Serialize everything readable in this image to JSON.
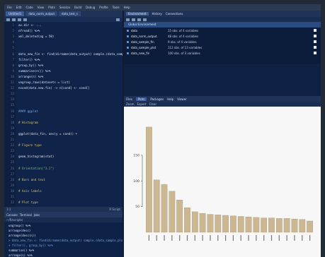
{
  "menubar": {
    "items": [
      "File",
      "Edit",
      "Code",
      "View",
      "Plots",
      "Session",
      "Build",
      "Debug",
      "Profile",
      "Tools",
      "Help"
    ]
  },
  "source": {
    "tabs": [
      "Untitled1",
      "data_norm_output",
      "data_test_s"
    ],
    "status_left": "1:1",
    "status_right": "R Script",
    "lines": [
      {
        "n": "1",
        "t": "  ax.dir <- ...",
        "c": "c-w"
      },
      {
        "n": "2",
        "t": "  nfread() %>%",
        "c": "c-w"
      },
      {
        "n": "3",
        "t": "  xml_deleted(ag = 50)",
        "c": "c-w"
      },
      {
        "n": "4",
        "t": "",
        "c": "c-w"
      },
      {
        "n": "5",
        "t": "",
        "c": "c-w"
      },
      {
        "n": "6",
        "t": "data_new_fin <- find(dirname(data_output) sample.(data_sample_plot)",
        "c": "c-w"
      },
      {
        "n": "7",
        "t": "  filter() %>%",
        "c": "c-w"
      },
      {
        "n": "8",
        "t": "  group_by() %>%",
        "c": "c-w"
      },
      {
        "n": "9",
        "t": "  summarise(n()) %>%",
        "c": "c-w"
      },
      {
        "n": "10",
        "t": "  arrange(n) %>%",
        "c": "c-w"
      },
      {
        "n": "11",
        "t": "  ungroup_rows(datasets = list)",
        "c": "c-w"
      },
      {
        "n": "12",
        "t": "ncond(data.new.fin) -> n[cond] <- cond[]",
        "c": "c-w"
      },
      {
        "n": "13",
        "t": "",
        "c": "c-w"
      },
      {
        "n": "14",
        "t": "",
        "c": "c-w"
      },
      {
        "n": "15",
        "t": "",
        "c": "c-w"
      },
      {
        "n": "16",
        "t": "#### ggplot",
        "c": "c-b"
      },
      {
        "n": "17",
        "t": "",
        "c": "c-w"
      },
      {
        "n": "18",
        "t": "# Histogram",
        "c": "c-y"
      },
      {
        "n": "19",
        "t": "",
        "c": "c-w"
      },
      {
        "n": "20",
        "t": "ggplot(data_fin, aes(y = cond)) +",
        "c": "c-w"
      },
      {
        "n": "21",
        "t": "",
        "c": "c-w"
      },
      {
        "n": "22",
        "t": "  # Figure type",
        "c": "c-y"
      },
      {
        "n": "23",
        "t": "",
        "c": "c-w"
      },
      {
        "n": "24",
        "t": "geom_histogram(stat)",
        "c": "c-w"
      },
      {
        "n": "25",
        "t": "",
        "c": "c-w"
      },
      {
        "n": "26",
        "t": "  # Orientation(\"3.2\")",
        "c": "c-g"
      },
      {
        "n": "27",
        "t": "",
        "c": "c-w"
      },
      {
        "n": "28",
        "t": "  # Bars and text",
        "c": "c-y"
      },
      {
        "n": "29",
        "t": "",
        "c": "c-w"
      },
      {
        "n": "30",
        "t": "  # Axis labels",
        "c": "c-y"
      },
      {
        "n": "31",
        "t": "",
        "c": "c-w"
      },
      {
        "n": "32",
        "t": "  # Plot type",
        "c": "c-y"
      }
    ]
  },
  "console": {
    "tabs": [
      "Console",
      "Terminal",
      "Jobs"
    ],
    "path": "~/R/scripts/",
    "lines": [
      {
        "t": "  ungroup() %>%",
        "c": "c-w"
      },
      {
        "t": "  arrange(desc)",
        "c": "c-w"
      },
      {
        "t": "  arrange(desc(n))",
        "c": "c-w"
      },
      {
        "t": "> data_new_fin <- find(dirname(data_output) sample.(data_sample_plot)",
        "c": "c-b"
      },
      {
        "t": "+ filter(), group_by() %>%",
        "c": "c-b"
      },
      {
        "t": "  summarise() %>%",
        "c": "c-w"
      },
      {
        "t": "  arrange(n) %>%",
        "c": "c-w"
      }
    ]
  },
  "environment": {
    "tabs": [
      "Environment",
      "History",
      "Connections"
    ],
    "scope": "Global Environment",
    "rows": [
      {
        "name": "data",
        "value": "15 obs. of 4 variables"
      },
      {
        "name": "data_norm_output",
        "value": "48 obs. of 4 variables"
      },
      {
        "name": "data_sample_fin",
        "value": "9 obs. of 4 variables"
      },
      {
        "name": "data_sample_plot",
        "value": "112 obs. of 13 variables"
      },
      {
        "name": "data_new_fin",
        "value": "100 obs. of 3 variables"
      }
    ]
  },
  "plots": {
    "tabs": [
      "Files",
      "Plots",
      "Packages",
      "Help",
      "Viewer"
    ],
    "toolbar": [
      "Zoom",
      "Export",
      "Clear"
    ]
  },
  "chart_data": {
    "type": "bar",
    "categories": [
      "",
      "",
      "",
      "",
      "",
      "",
      "",
      "",
      "",
      "",
      "",
      "",
      "",
      "",
      "",
      "",
      "",
      "",
      "",
      "",
      "",
      ""
    ],
    "values": [
      205,
      102,
      93,
      80,
      63,
      48,
      40,
      37,
      35,
      34,
      33,
      32,
      31,
      30,
      29,
      28,
      28,
      27,
      27,
      26,
      25,
      22
    ],
    "ylim": [
      0,
      220
    ],
    "yticks": [
      50,
      100,
      150
    ],
    "color": "#ccb793",
    "grid": false
  }
}
